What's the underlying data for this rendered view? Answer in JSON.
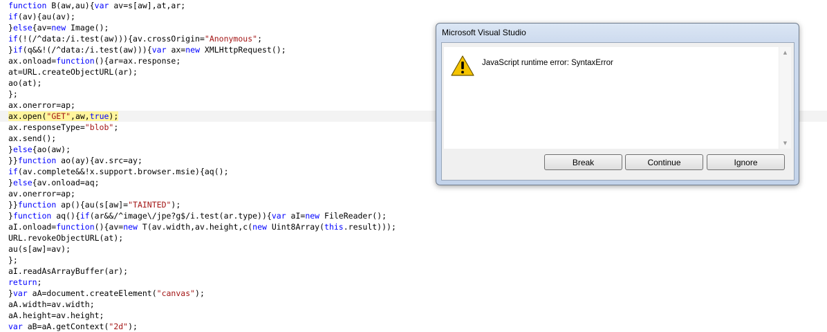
{
  "code": {
    "lines": [
      [
        [
          "k",
          "function"
        ],
        [
          "t",
          " B(aw,au){"
        ],
        [
          "k",
          "var"
        ],
        [
          "t",
          " av=s[aw],at,ar;"
        ]
      ],
      [
        [
          "k",
          "if"
        ],
        [
          "t",
          "(av){au(av);"
        ]
      ],
      [
        [
          "t",
          "}"
        ],
        [
          "k",
          "else"
        ],
        [
          "t",
          "{av="
        ],
        [
          "k",
          "new"
        ],
        [
          "t",
          " Image();"
        ]
      ],
      [
        [
          "k",
          "if"
        ],
        [
          "t",
          "(!(/^data:/i.test(aw))){av.crossOrigin="
        ],
        [
          "s",
          "\"Anonymous\""
        ],
        [
          "t",
          ";"
        ]
      ],
      [
        [
          "t",
          "}"
        ],
        [
          "k",
          "if"
        ],
        [
          "t",
          "(q&&!(/^data:/i.test(aw))){"
        ],
        [
          "k",
          "var"
        ],
        [
          "t",
          " ax="
        ],
        [
          "k",
          "new"
        ],
        [
          "t",
          " XMLHttpRequest();"
        ]
      ],
      [
        [
          "t",
          "ax.onload="
        ],
        [
          "k",
          "function"
        ],
        [
          "t",
          "(){ar=ax.response;"
        ]
      ],
      [
        [
          "t",
          "at=URL.createObjectURL(ar);"
        ]
      ],
      [
        [
          "t",
          "ao(at);"
        ]
      ],
      [
        [
          "t",
          "};"
        ]
      ],
      [
        [
          "t",
          "ax.onerror=ap;"
        ]
      ],
      [
        [
          "t",
          "ax.open("
        ],
        [
          "s",
          "\"GET\""
        ],
        [
          "t",
          ",aw,"
        ],
        [
          "k",
          "true"
        ],
        [
          "t",
          ");"
        ]
      ],
      [
        [
          "t",
          "ax.responseType="
        ],
        [
          "s",
          "\"blob\""
        ],
        [
          "t",
          ";"
        ]
      ],
      [
        [
          "t",
          "ax.send();"
        ]
      ],
      [
        [
          "t",
          "}"
        ],
        [
          "k",
          "else"
        ],
        [
          "t",
          "{ao(aw);"
        ]
      ],
      [
        [
          "t",
          "}}"
        ],
        [
          "k",
          "function"
        ],
        [
          "t",
          " ao(ay){av.src=ay;"
        ]
      ],
      [
        [
          "k",
          "if"
        ],
        [
          "t",
          "(av.complete&&!x.support.browser.msie){aq();"
        ]
      ],
      [
        [
          "t",
          "}"
        ],
        [
          "k",
          "else"
        ],
        [
          "t",
          "{av.onload=aq;"
        ]
      ],
      [
        [
          "t",
          "av.onerror=ap;"
        ]
      ],
      [
        [
          "t",
          "}}"
        ],
        [
          "k",
          "function"
        ],
        [
          "t",
          " ap(){au(s[aw]="
        ],
        [
          "s",
          "\"TAINTED\""
        ],
        [
          "t",
          ");"
        ]
      ],
      [
        [
          "t",
          "}"
        ],
        [
          "k",
          "function"
        ],
        [
          "t",
          " aq(){"
        ],
        [
          "k",
          "if"
        ],
        [
          "t",
          "(ar&&/^image\\/jpe?g$/i.test(ar.type)){"
        ],
        [
          "k",
          "var"
        ],
        [
          "t",
          " aI="
        ],
        [
          "k",
          "new"
        ],
        [
          "t",
          " FileReader();"
        ]
      ],
      [
        [
          "t",
          "aI.onload="
        ],
        [
          "k",
          "function"
        ],
        [
          "t",
          "(){av="
        ],
        [
          "k",
          "new"
        ],
        [
          "t",
          " T(av.width,av.height,c("
        ],
        [
          "k",
          "new"
        ],
        [
          "t",
          " Uint8Array("
        ],
        [
          "k",
          "this"
        ],
        [
          "t",
          ".result)));"
        ]
      ],
      [
        [
          "t",
          "URL.revokeObjectURL(at);"
        ]
      ],
      [
        [
          "t",
          "au(s[aw]=av);"
        ]
      ],
      [
        [
          "t",
          "};"
        ]
      ],
      [
        [
          "t",
          "aI.readAsArrayBuffer(ar);"
        ]
      ],
      [
        [
          "k",
          "return"
        ],
        [
          "t",
          ";"
        ]
      ],
      [
        [
          "t",
          "}"
        ],
        [
          "k",
          "var"
        ],
        [
          "t",
          " aA=document.createElement("
        ],
        [
          "s",
          "\"canvas\""
        ],
        [
          "t",
          ");"
        ]
      ],
      [
        [
          "t",
          "aA.width=av.width;"
        ]
      ],
      [
        [
          "t",
          "aA.height=av.height;"
        ]
      ],
      [
        [
          "k",
          "var"
        ],
        [
          "t",
          " aB=aA.getContext("
        ],
        [
          "s",
          "\"2d\""
        ],
        [
          "t",
          ");"
        ]
      ]
    ],
    "highlighted_line": 10
  },
  "dialog": {
    "title": "Microsoft Visual Studio",
    "message": "JavaScript runtime error: SyntaxError",
    "icon": "warning-icon",
    "buttons": {
      "break_label": "Break",
      "continue_label": "Continue",
      "ignore_label": "Ignore"
    }
  },
  "colors": {
    "keyword": "#0000ff",
    "string": "#a31515",
    "highlight": "#fff59d",
    "warning": "#f5c400"
  }
}
